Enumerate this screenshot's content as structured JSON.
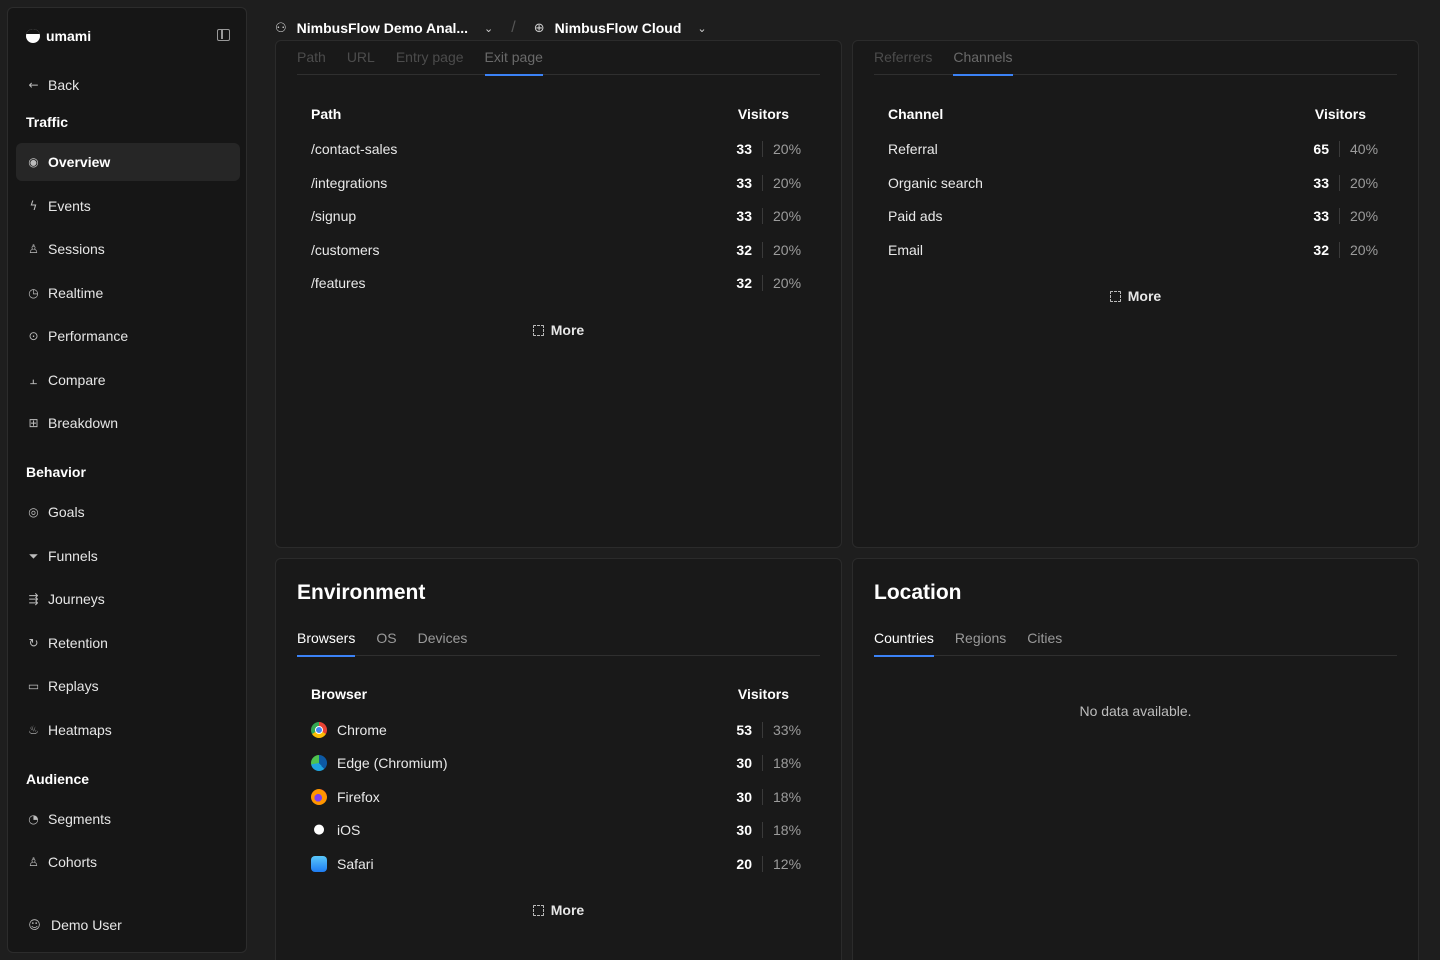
{
  "sidebar": {
    "brand": "umami",
    "back": "Back",
    "sections": {
      "traffic": "Traffic",
      "behavior": "Behavior",
      "audience": "Audience"
    },
    "traffic_items": [
      {
        "label": "Overview",
        "icon": "eye-icon"
      },
      {
        "label": "Events",
        "icon": "lightning-icon"
      },
      {
        "label": "Sessions",
        "icon": "user-icon"
      },
      {
        "label": "Realtime",
        "icon": "clock-icon"
      },
      {
        "label": "Performance",
        "icon": "gauge-icon"
      },
      {
        "label": "Compare",
        "icon": "compare-chart-icon"
      },
      {
        "label": "Breakdown",
        "icon": "grid-icon"
      }
    ],
    "behavior_items": [
      {
        "label": "Goals",
        "icon": "target-icon"
      },
      {
        "label": "Funnels",
        "icon": "funnel-icon"
      },
      {
        "label": "Journeys",
        "icon": "route-icon"
      },
      {
        "label": "Retention",
        "icon": "retention-icon"
      },
      {
        "label": "Replays",
        "icon": "video-icon"
      },
      {
        "label": "Heatmaps",
        "icon": "flame-icon"
      }
    ],
    "audience_items": [
      {
        "label": "Segments",
        "icon": "pie-icon"
      },
      {
        "label": "Cohorts",
        "icon": "user-plus-icon"
      }
    ],
    "user": "Demo User"
  },
  "header": {
    "team": "NimbusFlow Demo Anal...",
    "website": "NimbusFlow Cloud"
  },
  "pages_card": {
    "tabs": [
      "Path",
      "URL",
      "Entry page",
      "Exit page"
    ],
    "col_label": "Path",
    "col_value": "Visitors",
    "rows": [
      {
        "label": "/contact-sales",
        "count": "33",
        "pct": "20%"
      },
      {
        "label": "/integrations",
        "count": "33",
        "pct": "20%"
      },
      {
        "label": "/signup",
        "count": "33",
        "pct": "20%"
      },
      {
        "label": "/customers",
        "count": "32",
        "pct": "20%"
      },
      {
        "label": "/features",
        "count": "32",
        "pct": "20%"
      }
    ],
    "more": "More"
  },
  "sources_card": {
    "tabs": [
      "Referrers",
      "Channels"
    ],
    "col_label": "Channel",
    "col_value": "Visitors",
    "rows": [
      {
        "label": "Referral",
        "count": "65",
        "pct": "40%"
      },
      {
        "label": "Organic search",
        "count": "33",
        "pct": "20%"
      },
      {
        "label": "Paid ads",
        "count": "33",
        "pct": "20%"
      },
      {
        "label": "Email",
        "count": "32",
        "pct": "20%"
      }
    ],
    "more": "More"
  },
  "environment_card": {
    "title": "Environment",
    "tabs": [
      "Browsers",
      "OS",
      "Devices"
    ],
    "col_label": "Browser",
    "col_value": "Visitors",
    "rows": [
      {
        "label": "Chrome",
        "count": "53",
        "pct": "33%",
        "icon": "chrome-icon"
      },
      {
        "label": "Edge (Chromium)",
        "count": "30",
        "pct": "18%",
        "icon": "edge-icon"
      },
      {
        "label": "Firefox",
        "count": "30",
        "pct": "18%",
        "icon": "firefox-icon"
      },
      {
        "label": "iOS",
        "count": "30",
        "pct": "18%",
        "icon": "apple-icon"
      },
      {
        "label": "Safari",
        "count": "20",
        "pct": "12%",
        "icon": "safari-icon"
      }
    ],
    "more": "More"
  },
  "location_card": {
    "title": "Location",
    "tabs": [
      "Countries",
      "Regions",
      "Cities"
    ],
    "empty": "No data available."
  },
  "colors": {
    "accent": "#3b82f6",
    "background": "#1e1e1e",
    "card": "#191919"
  }
}
